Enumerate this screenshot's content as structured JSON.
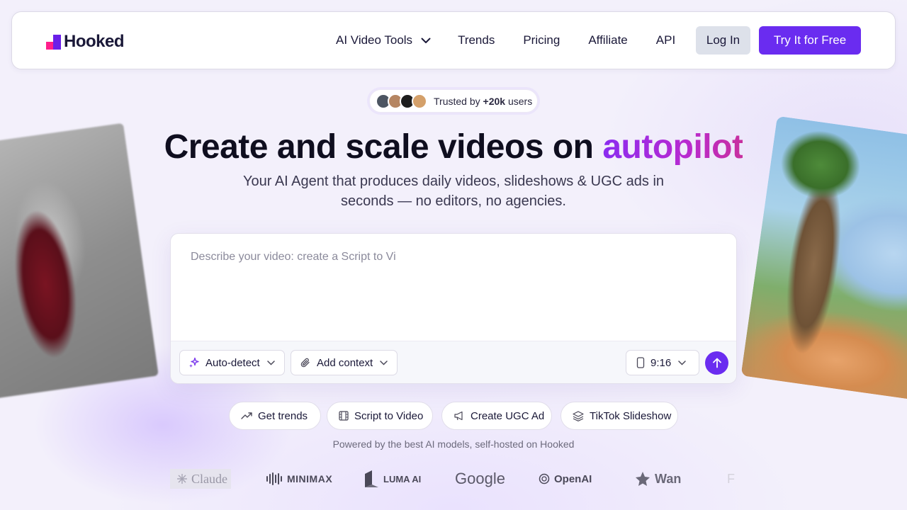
{
  "brand": {
    "name": "Hooked",
    "colors": {
      "primary": "#6a2cf0",
      "accent_pink": "#ff1f8b"
    }
  },
  "nav": {
    "links": [
      {
        "label": "AI Video Tools",
        "has_dropdown": true
      },
      {
        "label": "Trends"
      },
      {
        "label": "Pricing"
      },
      {
        "label": "Affiliate"
      },
      {
        "label": "API"
      }
    ],
    "login_label": "Log In",
    "cta_label": "Try It for Free"
  },
  "hero": {
    "trusted_prefix": "Trusted by",
    "trusted_count": "+20k",
    "trusted_suffix": "users",
    "headline_main": "Create and scale videos on ",
    "headline_accent": "autopilot",
    "subheadline": "Your AI Agent that produces daily videos, slideshows & UGC ads in seconds — no editors, no agencies."
  },
  "prompt": {
    "placeholder": "Describe your video: create a Script to Vi",
    "mode_label": "Auto-detect",
    "context_label": "Add context",
    "ratio_label": "9:16"
  },
  "chips": [
    {
      "label": "Get trends",
      "icon": "trending-up-icon"
    },
    {
      "label": "Script to Video",
      "icon": "film-icon"
    },
    {
      "label": "Create UGC Ad",
      "icon": "megaphone-icon"
    },
    {
      "label": "TikTok Slideshow",
      "icon": "layers-icon"
    }
  ],
  "powered_by": "Powered by the best AI models, self-hosted on Hooked",
  "models": [
    "Claude",
    "MINIMAX",
    "LUMA AI",
    "Google",
    "OpenAI",
    "Wan",
    "F"
  ]
}
